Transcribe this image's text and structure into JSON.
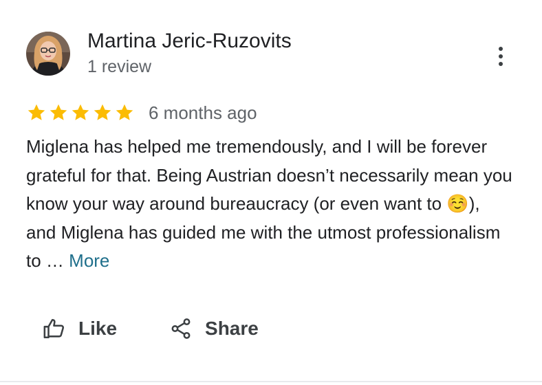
{
  "author": {
    "name": "Martina Jeric-Ruzovits",
    "review_count": "1 review",
    "avatar_icon": "profile-photo"
  },
  "menu": {
    "icon": "more-vertical-icon"
  },
  "rating": {
    "stars": 5,
    "max_stars": 5,
    "star_color": "#fbbc04",
    "time_ago": "6 months ago"
  },
  "review": {
    "text": "Miglena has helped me tremendously, and I will be forever grateful for that. Being Austrian doesn’t necessarily mean you know your way around bureaucracy (or even want to ☺️), and Miglena has guided me with the utmost professionalism to …",
    "more_label": "More",
    "more_color": "#1f6f8b"
  },
  "actions": {
    "like_label": "Like",
    "like_icon": "thumbs-up-icon",
    "share_label": "Share",
    "share_icon": "share-icon"
  }
}
